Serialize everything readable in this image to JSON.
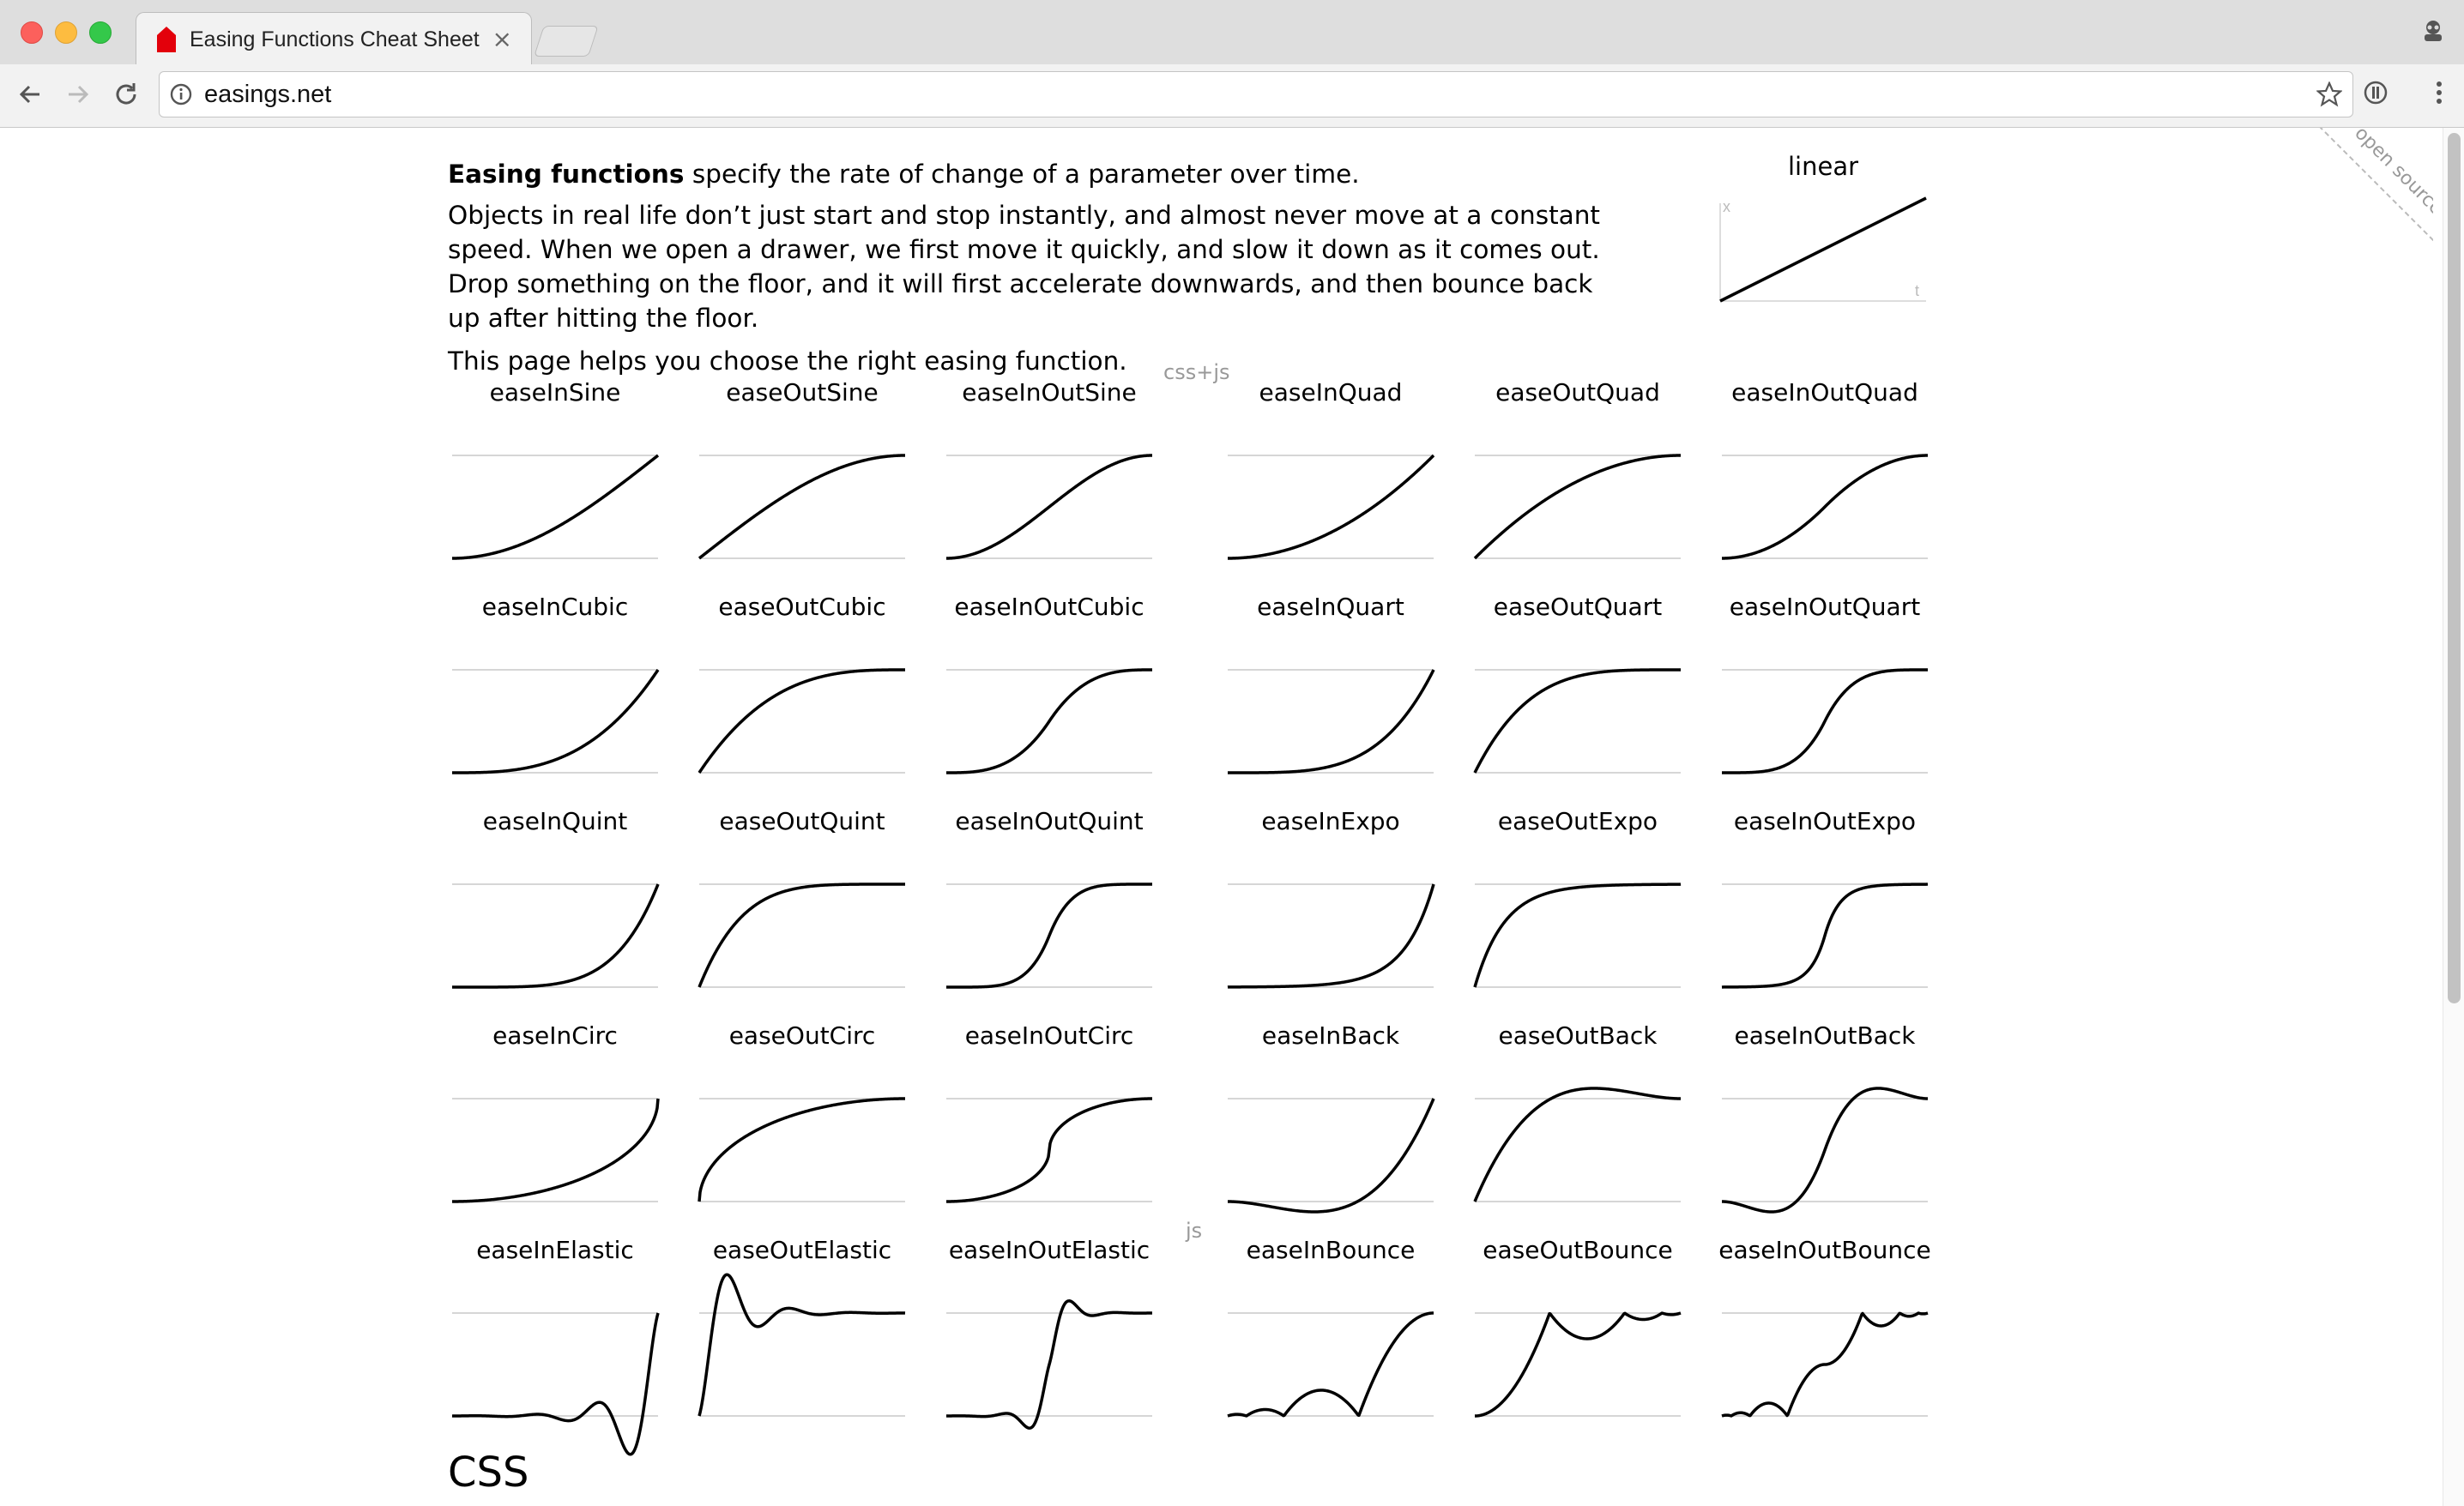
{
  "browser": {
    "tab_title": "Easing Functions Cheat Sheet",
    "tab_close": "×",
    "url": "easings.net"
  },
  "page": {
    "intro": {
      "bold": "Easing functions",
      "rest": " specify the rate of change of a parameter over time.",
      "paragraph2": "Objects in real life don’t just start and stop instantly, and almost never move at a constant speed. When we open a drawer, we first move it quickly, and slow it down as it comes out. Drop something on the floor, and it will first accelerate downwards, and then bounce back up after hitting the floor.",
      "paragraph3": "This page helps you choose the right easing function."
    },
    "linear": {
      "title": "linear",
      "axis_x": "x",
      "axis_t": "t"
    },
    "open_source": "open source",
    "tag_cssjs": "css+js",
    "tag_js": "js",
    "css_heading": "CSS",
    "easings": [
      "easeInSine",
      "easeOutSine",
      "easeInOutSine",
      "easeInQuad",
      "easeOutQuad",
      "easeInOutQuad",
      "easeInCubic",
      "easeOutCubic",
      "easeInOutCubic",
      "easeInQuart",
      "easeOutQuart",
      "easeInOutQuart",
      "easeInQuint",
      "easeOutQuint",
      "easeInOutQuint",
      "easeInExpo",
      "easeOutExpo",
      "easeInOutExpo",
      "easeInCirc",
      "easeOutCirc",
      "easeInOutCirc",
      "easeInBack",
      "easeOutBack",
      "easeInOutBack",
      "easeInElastic",
      "easeOutElastic",
      "easeInOutElastic",
      "easeInBounce",
      "easeOutBounce",
      "easeInOutBounce"
    ]
  }
}
